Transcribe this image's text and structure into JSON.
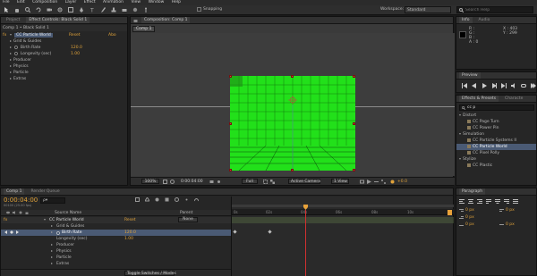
{
  "menu": [
    "File",
    "Edit",
    "Composition",
    "Layer",
    "Effect",
    "Animation",
    "View",
    "Window",
    "Help"
  ],
  "toolbar": {
    "snapping_label": "Snapping",
    "workspace_label": "Workspace:",
    "workspace_value": "Standard",
    "search_placeholder": "Search Help"
  },
  "left_panel": {
    "tabs": [
      "Project",
      "Effect Controls: Black Solid 1"
    ],
    "header": "Comp 1 • Black Solid 1",
    "effect": {
      "badge": "fx",
      "name": "CC Particle World",
      "reset": "Reset",
      "about": "Abo"
    },
    "props": [
      {
        "label": "Grid & Guides",
        "value": ""
      },
      {
        "label": "Birth Rate",
        "value": "120.0"
      },
      {
        "label": "Longevity (sec)",
        "value": "1.00"
      },
      {
        "label": "Producer",
        "value": ""
      },
      {
        "label": "Physics",
        "value": ""
      },
      {
        "label": "Particle",
        "value": ""
      },
      {
        "label": "Extras",
        "value": ""
      }
    ]
  },
  "comp_panel": {
    "title": "Composition: Comp 1",
    "tab": "Comp 1",
    "footer": {
      "zoom": "100%",
      "timecode": "0:00:04:00",
      "quality": "Full",
      "camera": "Active Camera",
      "views": "1 View",
      "exposure": "+0.0"
    }
  },
  "info_panel": {
    "tabs": [
      "Info",
      "Audio"
    ],
    "r": "R :",
    "g": "G :",
    "b": "B :",
    "a": "A : 0",
    "x": "X : 403",
    "y": "Y : 299"
  },
  "preview_panel": {
    "title": "Preview"
  },
  "effects_panel": {
    "tabs": [
      "Effects & Presets",
      "Characte"
    ],
    "search": "cc p",
    "groups": [
      {
        "name": "Distort",
        "items": [
          "CC Page Turn",
          "CC Power Pin"
        ]
      },
      {
        "name": "Simulation",
        "items": [
          "CC Particle Systems II",
          "CC Particle World",
          "CC Pixel Polly"
        ]
      },
      {
        "name": "Stylize",
        "items": [
          "CC Plastic"
        ]
      }
    ],
    "selected_item": "CC Particle World"
  },
  "timeline": {
    "tabs": [
      "Comp 1",
      "Render Queue"
    ],
    "timecode": "0:00:04:00",
    "frames": "00100 (25.00 fps)",
    "search_value": "ρ▾",
    "col_header": "Source Name",
    "parent_header": "Parent",
    "parent_value": "None",
    "layers": [
      {
        "label": "CC Particle World",
        "value": "Reset"
      },
      {
        "label": "Grid & Guides",
        "value": ""
      },
      {
        "label": "Birth Rate",
        "value": "120.0"
      },
      {
        "label": "Longevity (sec)",
        "value": "1.00"
      },
      {
        "label": "Producer",
        "value": ""
      },
      {
        "label": "Physics",
        "value": ""
      },
      {
        "label": "Particle",
        "value": ""
      },
      {
        "label": "Extras",
        "value": ""
      }
    ],
    "ruler": [
      "0s",
      "02s",
      "04s",
      "06s",
      "08s",
      "10s"
    ],
    "footer_label": "Toggle Switches / Modes"
  },
  "paragraph_panel": {
    "title": "Paragraph",
    "fields": [
      {
        "value": "0 px"
      },
      {
        "value": "0 px"
      },
      {
        "value": "0 px"
      },
      {
        "value": "0 px"
      },
      {
        "value": "0 px"
      }
    ]
  },
  "colors": {
    "accent_orange": "#e0a23a",
    "grid_green": "#22e01a",
    "selection_blue": "#4a5a74",
    "playhead": "#e8a23a"
  }
}
